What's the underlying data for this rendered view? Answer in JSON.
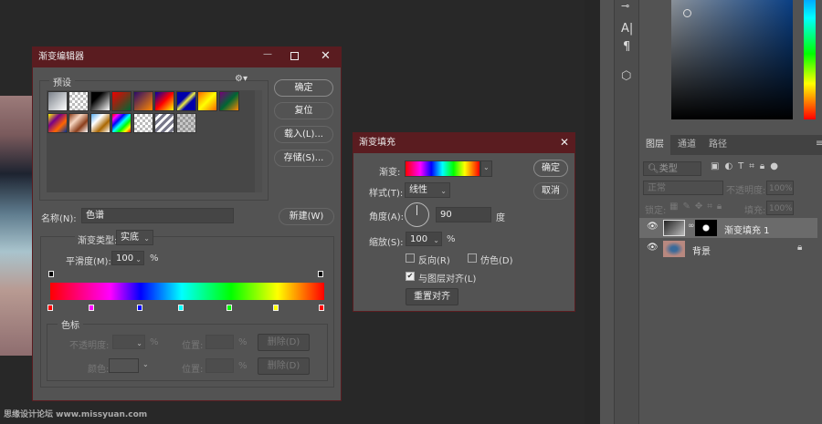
{
  "watermark": "思缘设计论坛 www.missyuan.com",
  "colors": {
    "title_bar": "#5a1c20",
    "panel": "#535353",
    "canvas": "#282828"
  },
  "gradient_editor": {
    "title": "渐变编辑器",
    "presets_label": "预设",
    "buttons": {
      "ok": "确定",
      "reset": "复位",
      "load": "载入(L)...",
      "save": "存储(S)...",
      "new": "新建(W)"
    },
    "name_label": "名称(N):",
    "name_value": "色谱",
    "type_label": "渐变类型:",
    "type_value": "实底",
    "smooth_label": "平滑度(M):",
    "smooth_value": "100",
    "smooth_unit": "%",
    "color_stops": [
      "#ff0000",
      "#ff00ff",
      "#0000ff",
      "#00ffff",
      "#00ff00",
      "#ffff00",
      "#ff0000"
    ],
    "stops_group": {
      "label": "色标",
      "opacity_label": "不透明度:",
      "percent": "%",
      "location_label": "位置:",
      "delete": "删除(D)",
      "color_label": "颜色:"
    }
  },
  "gradient_fill": {
    "title": "渐变填充",
    "gradient_label": "渐变:",
    "style_label": "样式(T):",
    "style_value": "线性",
    "angle_label": "角度(A):",
    "angle_value": "90",
    "angle_unit": "度",
    "scale_label": "缩放(S):",
    "scale_value": "100",
    "scale_unit": "%",
    "reverse": "反向(R)",
    "reverse_checked": false,
    "dither": "仿色(D)",
    "dither_checked": false,
    "align": "与图层对齐(L)",
    "align_checked": true,
    "reset_align": "重置对齐",
    "ok": "确定",
    "cancel": "取消"
  },
  "layers_panel": {
    "tabs": [
      "图层",
      "通道",
      "路径"
    ],
    "filter_value": "类型",
    "blend_mode": "正常",
    "opacity_label": "不透明度:",
    "opacity_value": "100%",
    "lock_label": "锁定:",
    "fill_label": "填充:",
    "fill_value": "100%",
    "layers": [
      {
        "name": "渐变填充 1",
        "visible": true,
        "selected": true
      },
      {
        "name": "背景",
        "visible": true,
        "locked": true
      }
    ]
  }
}
